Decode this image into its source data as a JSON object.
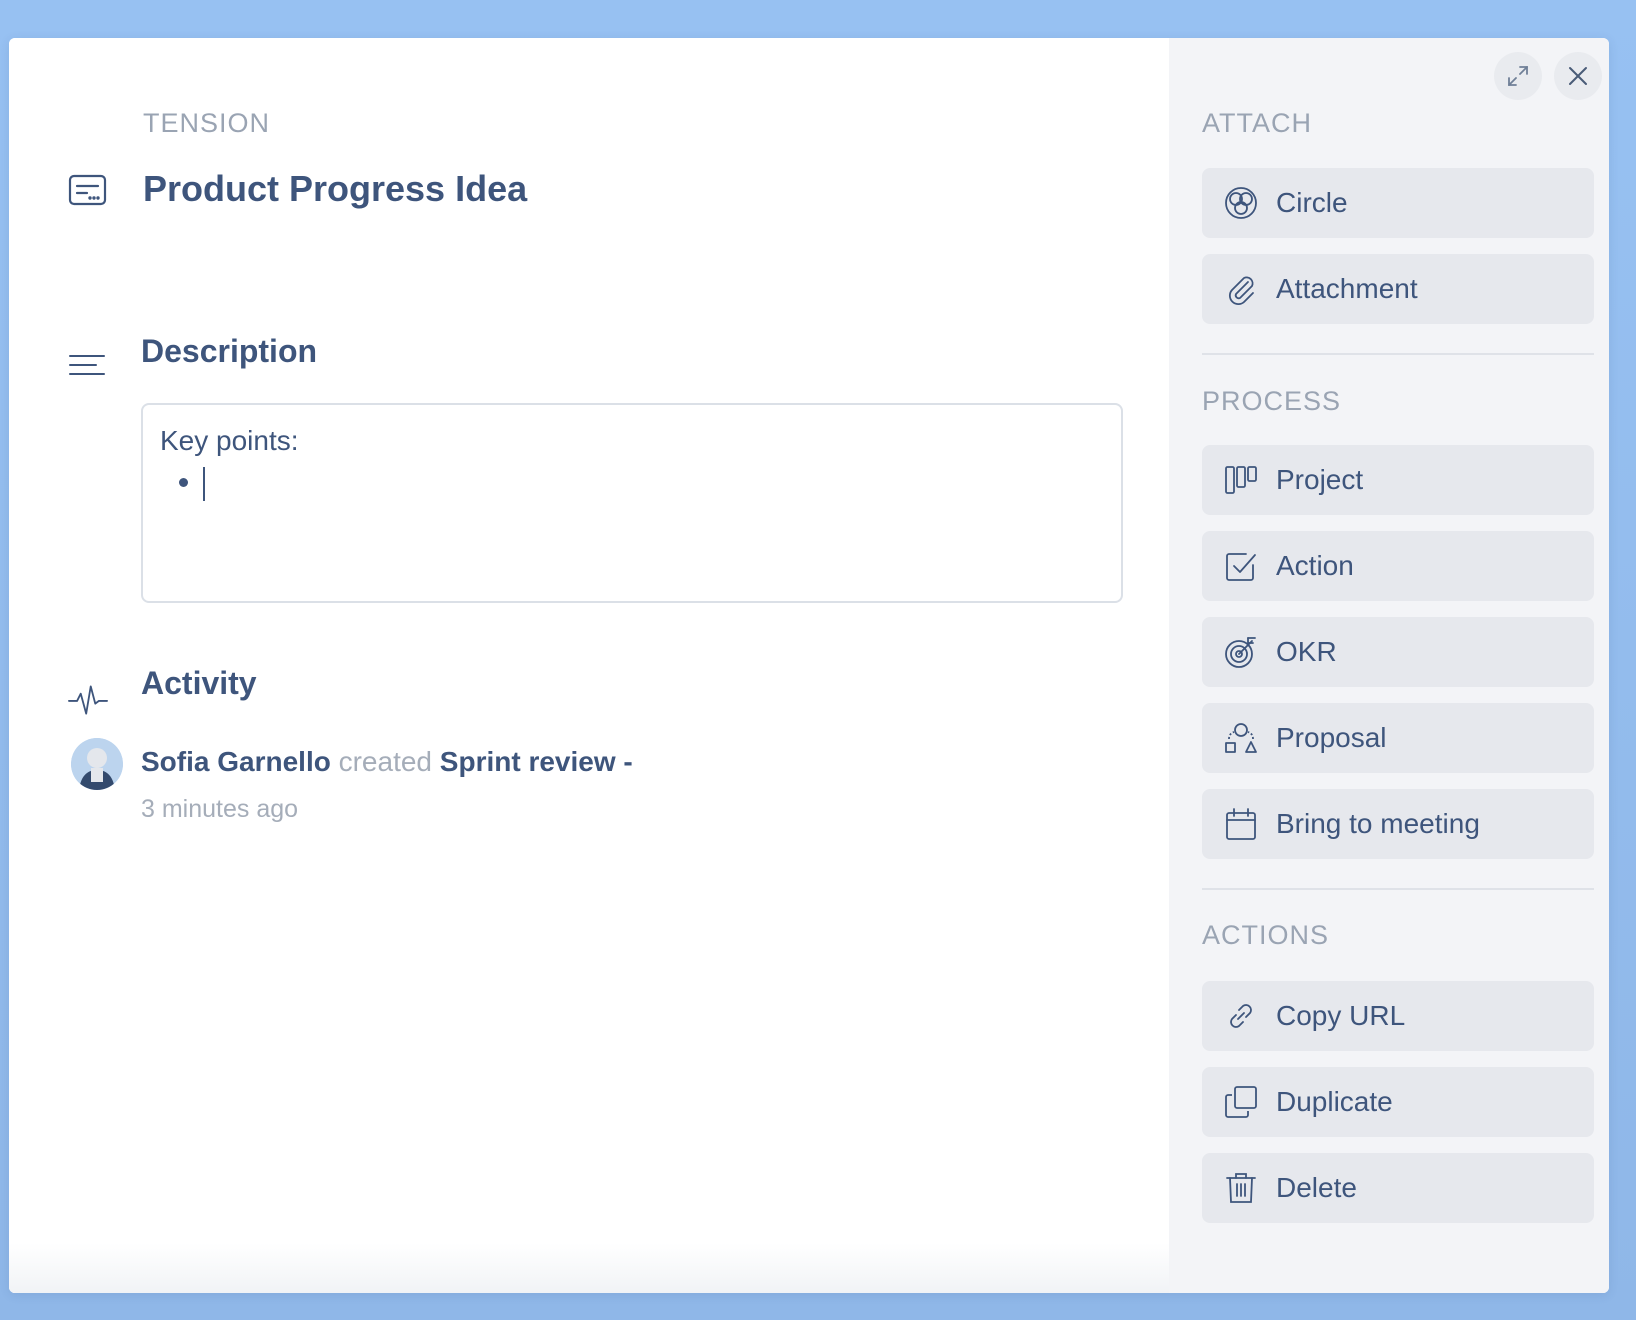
{
  "tension": {
    "type_label": "TENSION",
    "title": "Product Progress Idea"
  },
  "description": {
    "heading": "Description",
    "content": "Key points:"
  },
  "activity": {
    "heading": "Activity",
    "entries": [
      {
        "actor": "Sofia Garnello",
        "verb": "created",
        "target": "Sprint review -",
        "time": "3 minutes ago"
      }
    ]
  },
  "sidebar": {
    "attach": {
      "label": "ATTACH",
      "items": [
        {
          "label": "Circle",
          "icon": "circle-icon"
        },
        {
          "label": "Attachment",
          "icon": "paperclip-icon"
        }
      ]
    },
    "process": {
      "label": "PROCESS",
      "items": [
        {
          "label": "Project",
          "icon": "kanban-icon"
        },
        {
          "label": "Action",
          "icon": "checkbox-icon"
        },
        {
          "label": "OKR",
          "icon": "target-icon"
        },
        {
          "label": "Proposal",
          "icon": "shapes-icon"
        },
        {
          "label": "Bring to meeting",
          "icon": "calendar-icon"
        }
      ]
    },
    "actions": {
      "label": "ACTIONS",
      "items": [
        {
          "label": "Copy URL",
          "icon": "link-icon"
        },
        {
          "label": "Duplicate",
          "icon": "duplicate-icon"
        },
        {
          "label": "Delete",
          "icon": "trash-icon"
        }
      ]
    }
  },
  "colors": {
    "backdrop": "#93bff0",
    "text": "#3e557c",
    "muted": "#9aa4b3",
    "sidebar_bg": "#f3f4f7",
    "button_bg": "#e6e8ed"
  }
}
